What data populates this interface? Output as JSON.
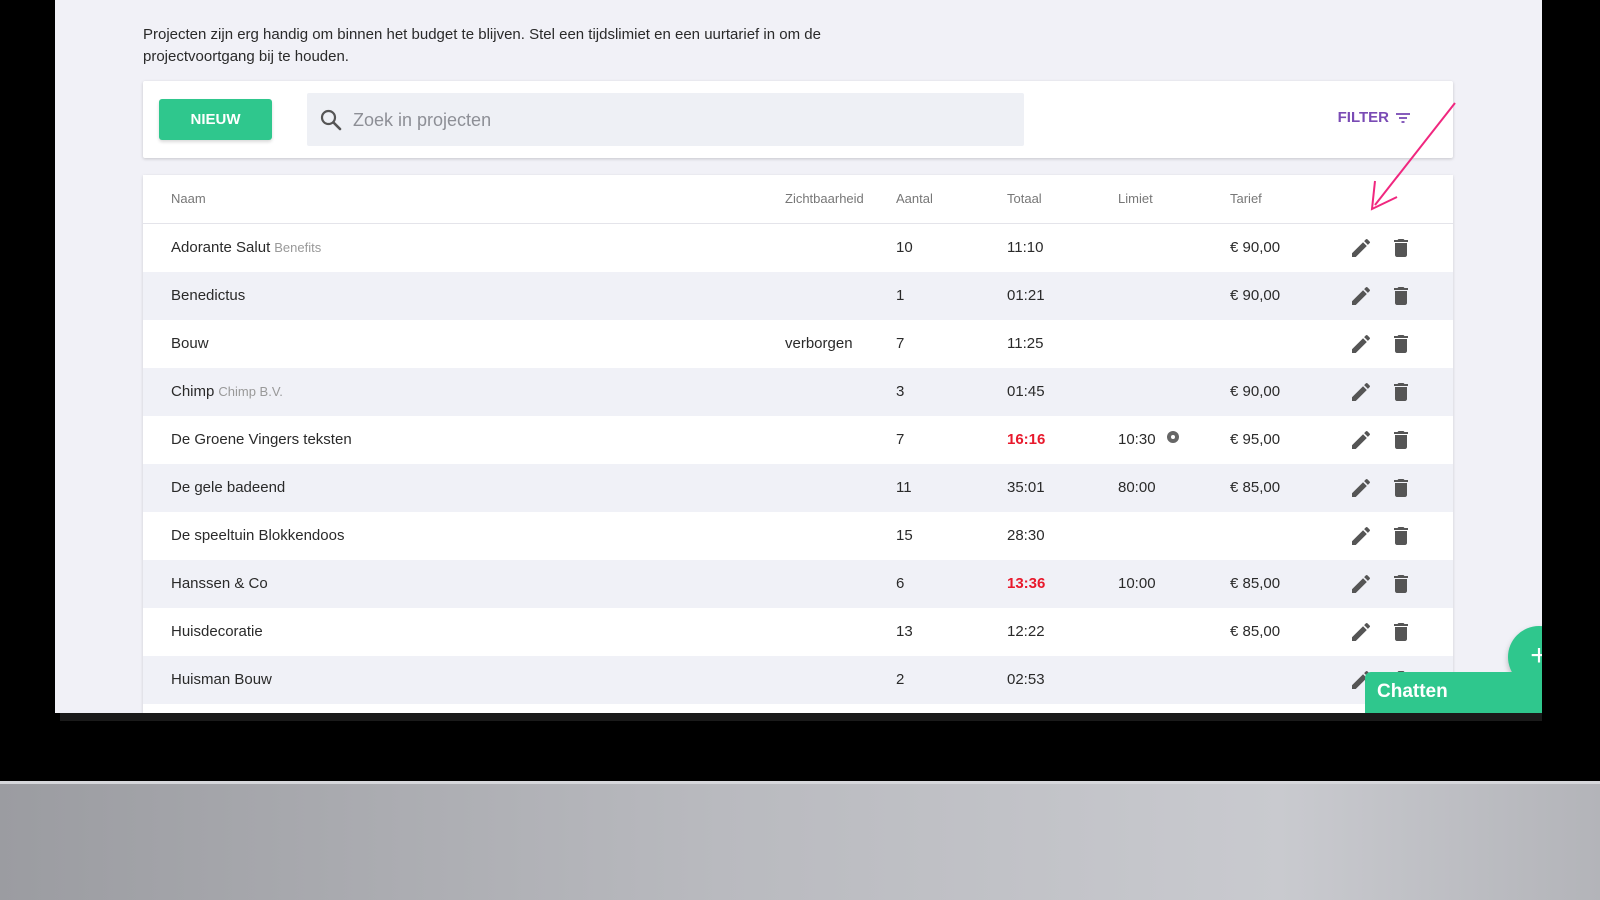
{
  "intro_text": "Projecten zijn erg handig om binnen het budget te blijven. Stel een tijdslimiet en een uurtarief in om de projectvoortgang bij te houden.",
  "toolbar": {
    "new_label": "NIEUW",
    "search_placeholder": "Zoek in projecten",
    "filter_label": "FILTER"
  },
  "table": {
    "headers": {
      "name": "Naam",
      "visibility": "Zichtbaarheid",
      "count": "Aantal",
      "total": "Totaal",
      "limit": "Limiet",
      "rate": "Tarief"
    },
    "rows": [
      {
        "name": "Adorante Salut",
        "client": "Benefits",
        "visibility": "",
        "count": "10",
        "total": "11:10",
        "total_over": false,
        "limit": "",
        "rate": "€ 90,00"
      },
      {
        "name": "Benedictus",
        "client": "",
        "visibility": "",
        "count": "1",
        "total": "01:21",
        "total_over": false,
        "limit": "",
        "rate": "€ 90,00"
      },
      {
        "name": "Bouw",
        "client": "",
        "visibility": "verborgen",
        "count": "7",
        "total": "11:25",
        "total_over": false,
        "limit": "",
        "rate": ""
      },
      {
        "name": "Chimp",
        "client": "Chimp B.V.",
        "visibility": "",
        "count": "3",
        "total": "01:45",
        "total_over": false,
        "limit": "",
        "rate": "€ 90,00"
      },
      {
        "name": "De Groene Vingers teksten",
        "client": "",
        "visibility": "",
        "count": "7",
        "total": "16:16",
        "total_over": true,
        "limit": "10:30",
        "limit_icon": true,
        "rate": "€ 95,00"
      },
      {
        "name": "De gele badeend",
        "client": "",
        "visibility": "",
        "count": "11",
        "total": "35:01",
        "total_over": false,
        "limit": "80:00",
        "rate": "€ 85,00"
      },
      {
        "name": "De speeltuin Blokkendoos",
        "client": "",
        "visibility": "",
        "count": "15",
        "total": "28:30",
        "total_over": false,
        "limit": "",
        "rate": ""
      },
      {
        "name": "Hanssen & Co",
        "client": "",
        "visibility": "",
        "count": "6",
        "total": "13:36",
        "total_over": true,
        "limit": "10:00",
        "rate": "€ 85,00"
      },
      {
        "name": "Huisdecoratie",
        "client": "",
        "visibility": "",
        "count": "13",
        "total": "12:22",
        "total_over": false,
        "limit": "",
        "rate": "€ 85,00"
      },
      {
        "name": "Huisman Bouw",
        "client": "",
        "visibility": "",
        "count": "2",
        "total": "02:53",
        "total_over": false,
        "limit": "",
        "rate": ""
      }
    ]
  },
  "fab_label": "+",
  "chat_label": "Chatten",
  "icons": {
    "search": "search-icon",
    "filter": "filter-icon",
    "edit": "pencil-icon",
    "delete": "trash-icon",
    "limit_warning": "warning-icon",
    "chat_toggle": "chevron-up-icon",
    "annotation": "arrow-icon"
  },
  "colors": {
    "accent": "#2fc78d",
    "filter": "#7a4bb5",
    "over_budget": "#e8192c",
    "annotation_arrow": "#f0277f"
  }
}
